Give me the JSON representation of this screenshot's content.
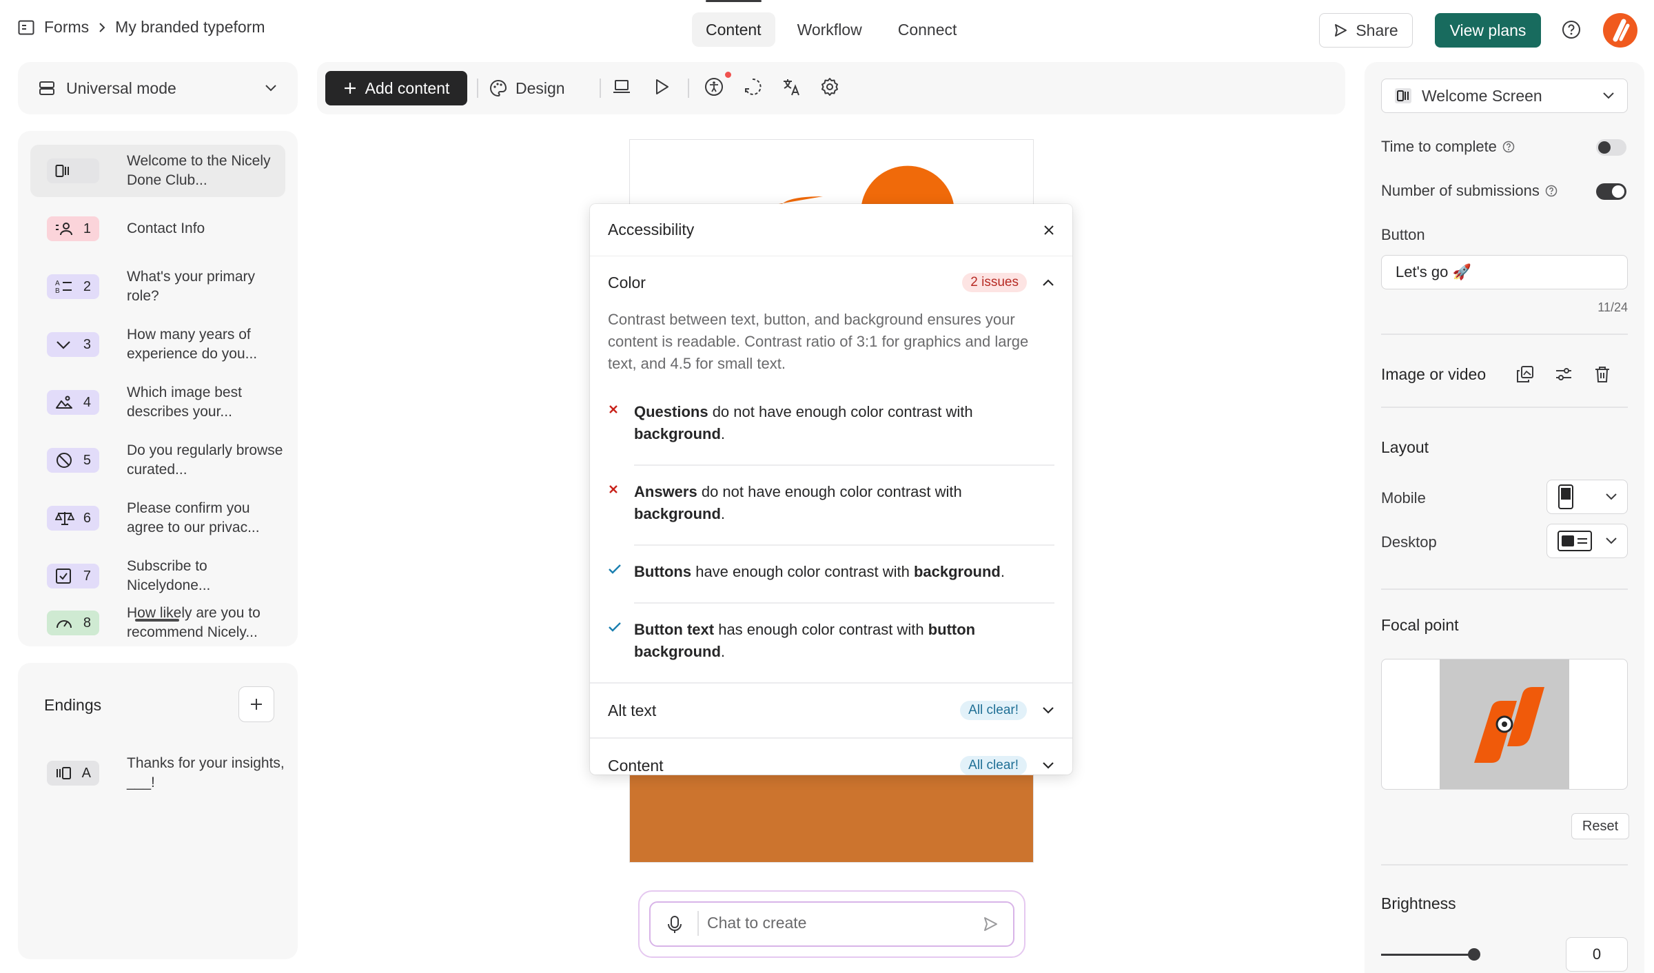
{
  "breadcrumb": {
    "root": "Forms",
    "current": "My branded typeform"
  },
  "topnav": {
    "tabs": [
      "Content",
      "Workflow",
      "Connect"
    ],
    "active": "Content"
  },
  "header": {
    "share_label": "Share",
    "plans_label": "View plans"
  },
  "mode": {
    "label": "Universal mode"
  },
  "questions": [
    {
      "num": "",
      "label": "Welcome to the Nicely Done Club...",
      "icon": "welcome-screen-icon",
      "color": "#e4e4e6"
    },
    {
      "num": "1",
      "label": "Contact Info",
      "icon": "contact-info-icon",
      "color": "#fbd4da"
    },
    {
      "num": "2",
      "label": "What's your primary role?",
      "icon": "multiple-choice-icon",
      "color": "#e2dcf9"
    },
    {
      "num": "3",
      "label": "How many years of experience do you...",
      "icon": "dropdown-icon",
      "color": "#e2dcf9"
    },
    {
      "num": "4",
      "label": "Which image best describes your...",
      "icon": "picture-choice-icon",
      "color": "#e2dcf9"
    },
    {
      "num": "5",
      "label": "Do you regularly browse curated...",
      "icon": "yes-no-icon",
      "color": "#e2dcf9"
    },
    {
      "num": "6",
      "label": "Please confirm you agree to our privac...",
      "icon": "legal-icon",
      "color": "#e2dcf9"
    },
    {
      "num": "7",
      "label": "Subscribe to Nicelydone...",
      "icon": "checkbox-icon",
      "color": "#e2dcf9"
    },
    {
      "num": "8",
      "label": "How likely are you to recommend Nicely...",
      "icon": "nps-icon",
      "color": "#cfead2"
    }
  ],
  "endings": {
    "title": "Endings",
    "items": [
      {
        "num": "A",
        "label": "Thanks for your insights, ___!"
      }
    ]
  },
  "toolbar": {
    "add_label": "Add content",
    "design_label": "Design"
  },
  "chat": {
    "placeholder": "Chat to create"
  },
  "accessibility": {
    "title": "Accessibility",
    "color": {
      "title": "Color",
      "issues": "2 issues",
      "description": "Contrast between text, button, and background ensures your content is readable. Contrast ratio of 3:1 for graphics and large text, and 4.5 for small text.",
      "checks": [
        {
          "status": "fail",
          "subject": "Questions",
          "middle": " do not have enough color contrast with ",
          "object": "background",
          "end": "."
        },
        {
          "status": "fail",
          "subject": "Answers",
          "middle": " do not have enough color contrast with ",
          "object": "background",
          "end": "."
        },
        {
          "status": "pass",
          "subject": "Buttons",
          "middle": " have enough color contrast with ",
          "object": "background",
          "end": "."
        },
        {
          "status": "pass",
          "subject": "Button text",
          "middle": " has enough color contrast with ",
          "object": "button background",
          "end": "."
        }
      ]
    },
    "alt_text": {
      "title": "Alt text",
      "status": "All clear!"
    },
    "content": {
      "title": "Content",
      "status": "All clear!"
    }
  },
  "settings": {
    "screen_select": "Welcome Screen",
    "time_to_complete": {
      "label": "Time to complete",
      "on": false
    },
    "submissions": {
      "label": "Number of submissions",
      "on": true
    },
    "button": {
      "label": "Button",
      "value": "Let's go 🚀",
      "count": "11/24"
    },
    "image_label": "Image or video",
    "layout": {
      "title": "Layout",
      "mobile": "Mobile",
      "desktop": "Desktop"
    },
    "focal": {
      "title": "Focal point",
      "reset": "Reset"
    },
    "brightness": {
      "title": "Brightness",
      "value": "0"
    }
  },
  "colors": {
    "brand": "#186b5e",
    "accent": "#f05a1e",
    "orange_block": "#cc742e"
  }
}
